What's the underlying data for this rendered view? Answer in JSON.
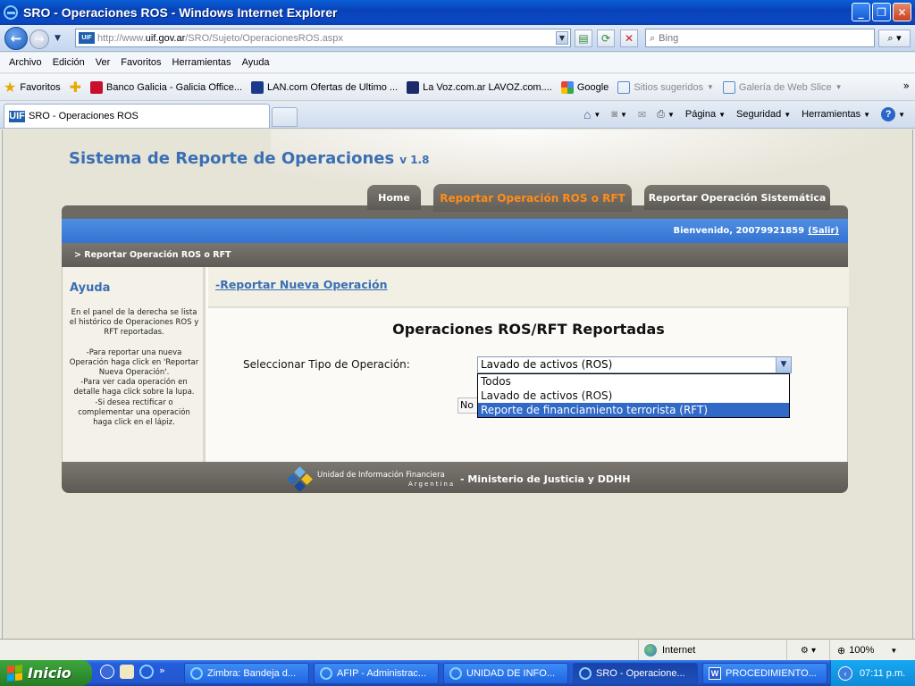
{
  "window": {
    "title": "SRO - Operaciones ROS - Windows Internet Explorer",
    "controls": [
      "_",
      "❐",
      "✕"
    ]
  },
  "address": {
    "url_prefix": "http://www.",
    "url_domain": "uif.gov.ar",
    "url_path": "/SRO/Sujeto/OperacionesROS.aspx",
    "search_placeholder": "Bing",
    "favicon_text": "UIF"
  },
  "menu": [
    "Archivo",
    "Edición",
    "Ver",
    "Favoritos",
    "Herramientas",
    "Ayuda"
  ],
  "favorites_bar": {
    "label": "Favoritos",
    "items": [
      {
        "label": "Banco Galicia - Galicia Office...",
        "color": "#c8102e",
        "muted": false
      },
      {
        "label": "LAN.com Ofertas de Ultimo ...",
        "color": "#1a3a8a",
        "muted": false
      },
      {
        "label": "La Voz.com.ar  LAVOZ.com....",
        "color": "#1a2a6a",
        "muted": false
      },
      {
        "label": "Google",
        "color": "#4a8af4",
        "muted": false
      },
      {
        "label": "Sitios sugeridos",
        "color": "#5a8ac8",
        "muted": true,
        "dropdown": true
      },
      {
        "label": "Galería de Web Slice",
        "color": "#5a8ac8",
        "muted": true,
        "dropdown": true
      }
    ],
    "overflow": "»"
  },
  "tabs": {
    "active_title": "SRO - Operaciones ROS"
  },
  "command_bar": {
    "items": [
      "Página",
      "Seguridad",
      "Herramientas"
    ],
    "help": "?"
  },
  "page": {
    "site_title": "Sistema de Reporte de Operaciones",
    "version": "v 1.8",
    "nav": {
      "home": "Home",
      "report_ros": "Reportar Operación ROS o RFT",
      "report_system": "Reportar Operación Sistemática"
    },
    "welcome_prefix": "Bienvenido, 20079921859",
    "logout": "(Salir)",
    "breadcrumb": "> Reportar Operación ROS o RFT",
    "sidebar": {
      "title": "Ayuda",
      "text_1": "En el panel de la derecha se lista el histórico de Operaciones ROS y RFT reportadas.",
      "text_2": "-Para reportar una nueva Operación haga click en 'Reportar Nueva Operación'.",
      "text_3": "-Para ver cada operación en detalle haga click sobre la lupa.",
      "text_4": "-Si desea rectificar o complementar una operación haga click en el lápiz."
    },
    "new_operation_link": "-Reportar Nueva Operación",
    "section_title": "Operaciones ROS/RFT Reportadas",
    "select_label": "Seleccionar Tipo de Operación:",
    "select_value": "Lavado de activos (ROS)",
    "select_options": [
      "Todos",
      "Lavado de activos (ROS)",
      "Reporte de financiamiento terrorista (RFT)"
    ],
    "highlighted_option": "Reporte de financiamiento terrorista (RFT)",
    "hidden_text_fragment": "No h",
    "footer": {
      "org_name": "Unidad de Información Financiera",
      "country": "Argentina",
      "ministry": "- Ministerio de Justicia y DDHH"
    }
  },
  "status": {
    "zone": "Internet",
    "zoom": "100%"
  },
  "taskbar": {
    "start": "Inicio",
    "overflow": "»",
    "buttons": [
      {
        "label": "Zimbra: Bandeja d...",
        "kind": "ie",
        "active": false
      },
      {
        "label": "AFIP - Administrac...",
        "kind": "ie",
        "active": false
      },
      {
        "label": "UNIDAD DE INFO...",
        "kind": "ie",
        "active": false
      },
      {
        "label": "SRO - Operacione...",
        "kind": "ie",
        "active": true
      },
      {
        "label": "PROCEDIMIENTO...",
        "kind": "word",
        "active": false
      }
    ],
    "clock": "07:11 p.m."
  },
  "colors": {
    "brand_blue": "#3a6fb3",
    "active_tab_orange": "#ff8c1a",
    "welcome_bar_blue": "#3f80da",
    "selected_option_bg": "#3169c6"
  }
}
